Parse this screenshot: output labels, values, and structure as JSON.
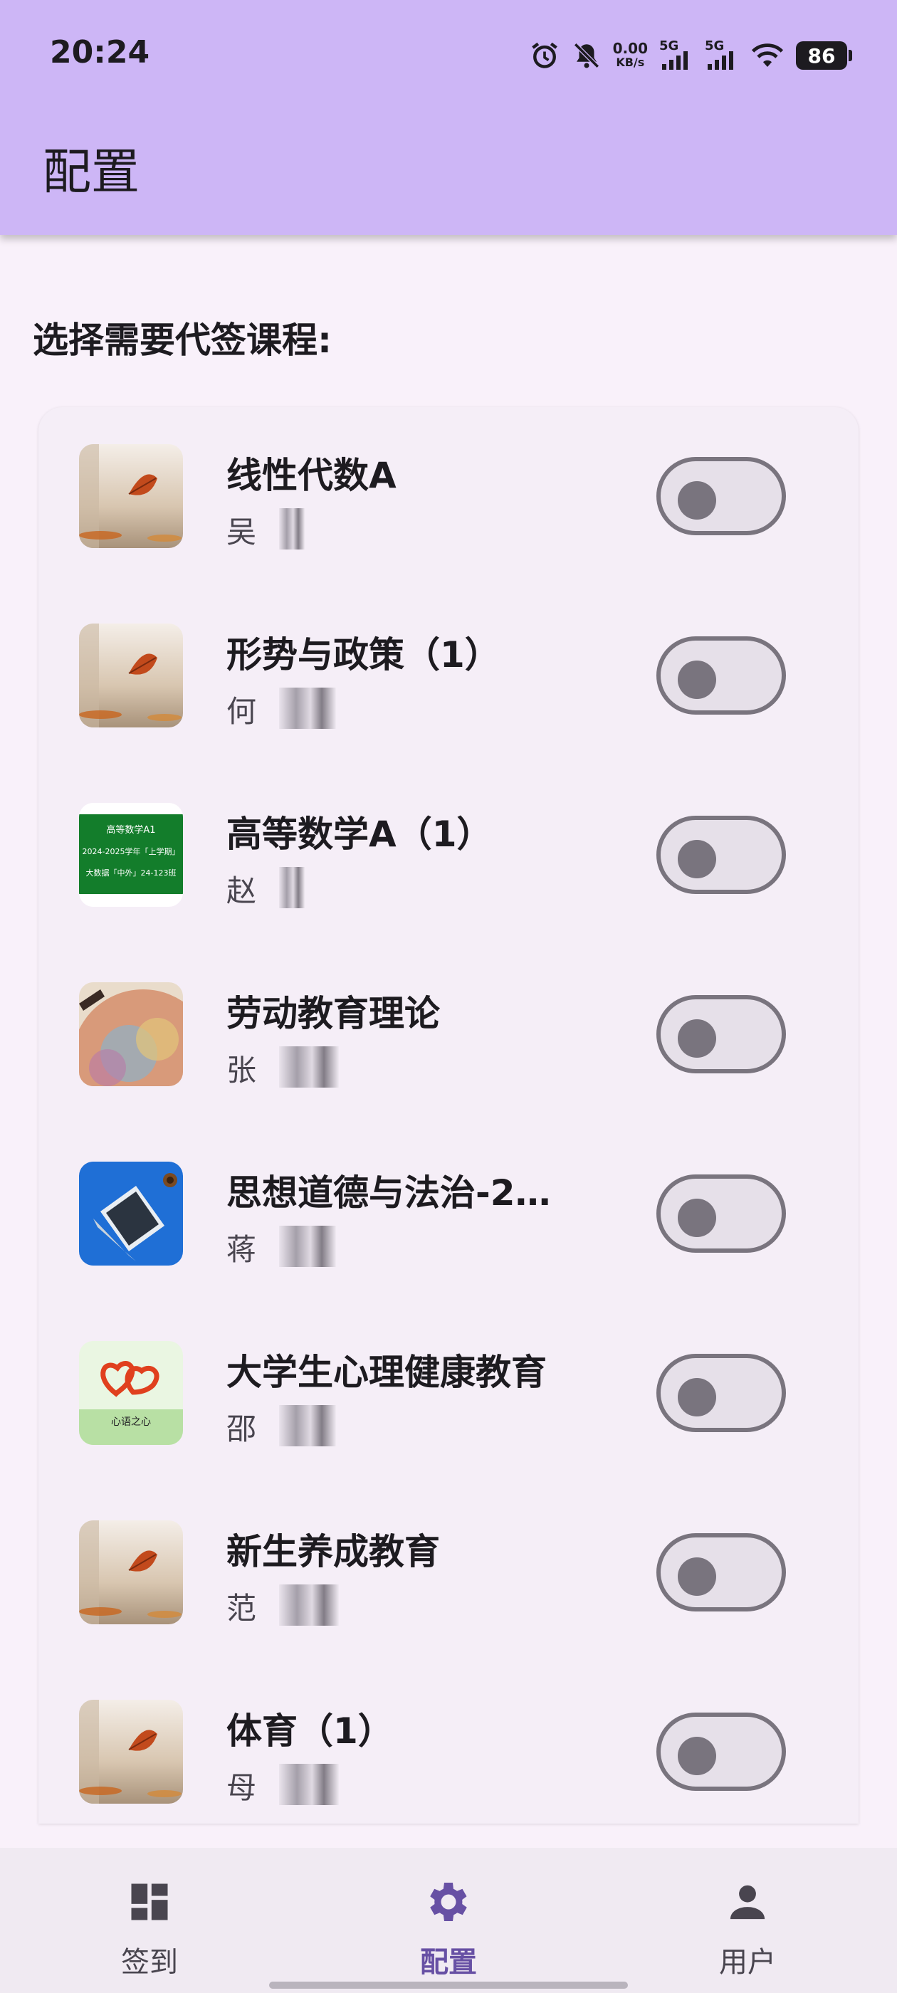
{
  "status_bar": {
    "time": "20:24",
    "net_speed_value": "0.00",
    "net_speed_unit": "KB/s",
    "signal_1_label": "5G",
    "signal_2_label": "5G",
    "battery": "86",
    "icons": [
      "alarm-icon",
      "bell-off-icon",
      "signal-icon",
      "signal-icon",
      "wifi-icon",
      "battery-icon"
    ]
  },
  "app_bar": {
    "title": "配置"
  },
  "section": {
    "heading": "选择需要代签课程:"
  },
  "courses": [
    {
      "name": "线性代数A",
      "teacher": "吴",
      "thumb": "leaf",
      "enabled": false
    },
    {
      "name": "形势与政策（1）",
      "teacher": "何",
      "thumb": "leaf",
      "enabled": false
    },
    {
      "name": "高等数学A（1）",
      "teacher": "赵",
      "thumb": "chalkboard",
      "enabled": false
    },
    {
      "name": "劳动教育理论",
      "teacher": "张",
      "thumb": "map",
      "enabled": false
    },
    {
      "name": "思想道德与法治-2…",
      "teacher": "蒋",
      "thumb": "laptop",
      "enabled": false
    },
    {
      "name": "大学生心理健康教育",
      "teacher": "邵",
      "thumb": "heart",
      "enabled": false
    },
    {
      "name": "新生养成教育",
      "teacher": "范",
      "thumb": "leaf",
      "enabled": false
    },
    {
      "name": "体育（1）",
      "teacher": "母",
      "thumb": "leaf",
      "enabled": false
    }
  ],
  "thumb_text": {
    "chalkboard_line1": "高等数学A1",
    "chalkboard_line2": "2024-2025学年「上学期」",
    "chalkboard_line3": "大数据「中外」24-123班",
    "heart_line1": "心语之心"
  },
  "bottom_nav": [
    {
      "label": "签到",
      "icon": "dashboard-icon",
      "active": false
    },
    {
      "label": "配置",
      "icon": "gear-icon",
      "active": true
    },
    {
      "label": "用户",
      "icon": "person-icon",
      "active": false
    }
  ],
  "colors": {
    "app_bar": "#cdb6f6",
    "background": "#f9f1fa",
    "card": "#f5eef7",
    "accent": "#6750a4",
    "switch_off": "#79747e"
  }
}
